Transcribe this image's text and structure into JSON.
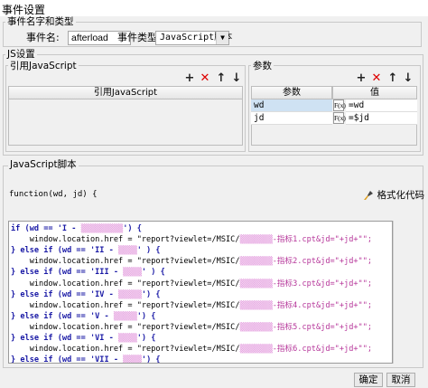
{
  "window": {
    "title": "事件设置"
  },
  "event_group": {
    "legend": "事件名字和类型",
    "name_label": "事件名:",
    "name_value": "afterload",
    "type_label": "事件类型:",
    "type_value": "JavaScript脚本"
  },
  "js_group": {
    "legend": "JS设置",
    "ref_legend": "引用JavaScript",
    "ref_header": "引用JavaScript",
    "params_legend": "参数",
    "params_headers": [
      "参数",
      "值"
    ],
    "params_rows": [
      {
        "name": "wd",
        "fx": "F(x)",
        "value": "=wd"
      },
      {
        "name": "jd",
        "fx": "F(x)",
        "value": "=$jd"
      }
    ]
  },
  "script_group": {
    "legend": "JavaScript脚本",
    "signature": "function(wd, jd) {",
    "format_button": "格式化代码"
  },
  "toolbar": {
    "add": "+",
    "delete": "✕",
    "up": "↑",
    "down": "↓"
  },
  "code": {
    "lines": [
      [
        "if (wd == 'I - ",
        "▒▒▒▒▒▒▒▒▒",
        "') {"
      ],
      [
        "    window.location.href = \"report?viewlet=/MSIC/",
        "▒▒▒▒▒▒▒",
        "-指标1.cpt&jd=\"+jd+\"\";"
      ],
      [
        "} else if (wd == 'II - ",
        "▒▒▒▒",
        "' ) {"
      ],
      [
        "    window.location.href = \"report?viewlet=/MSIC/",
        "▒▒▒▒▒▒▒",
        "-指标2.cpt&jd=\"+jd+\"\";"
      ],
      [
        "} else if (wd == 'III - ",
        "▒▒▒▒",
        "' ) {"
      ],
      [
        "    window.location.href = \"report?viewlet=/MSIC/",
        "▒▒▒▒▒▒▒",
        "-指标3.cpt&jd=\"+jd+\"\";"
      ],
      [
        "} else if (wd == 'IV - ",
        "▒▒▒▒▒",
        "') {"
      ],
      [
        "    window.location.href = \"report?viewlet=/MSIC/",
        "▒▒▒▒▒▒▒",
        "-指标4.cpt&jd=\"+jd+\"\";"
      ],
      [
        "} else if (wd == 'V - ",
        "▒▒▒▒▒",
        "') {"
      ],
      [
        "    window.location.href = \"report?viewlet=/MSIC/",
        "▒▒▒▒▒▒▒",
        "-指标5.cpt&jd=\"+jd+\"\";"
      ],
      [
        "} else if (wd == 'VI - ",
        "▒▒▒▒",
        "') {"
      ],
      [
        "    window.location.href = \"report?viewlet=/MSIC/",
        "▒▒▒▒▒▒▒",
        "-指标6.cpt&jd=\"+jd+\"\";"
      ],
      [
        "} else if (wd == 'VII - ",
        "▒▒▒▒",
        "') {"
      ]
    ],
    "closing": "}"
  },
  "footer": {
    "ok": "确定",
    "cancel": "取消"
  },
  "colors": {
    "selected_row": "#cfe2f3",
    "delete_icon": "#dd0000"
  }
}
